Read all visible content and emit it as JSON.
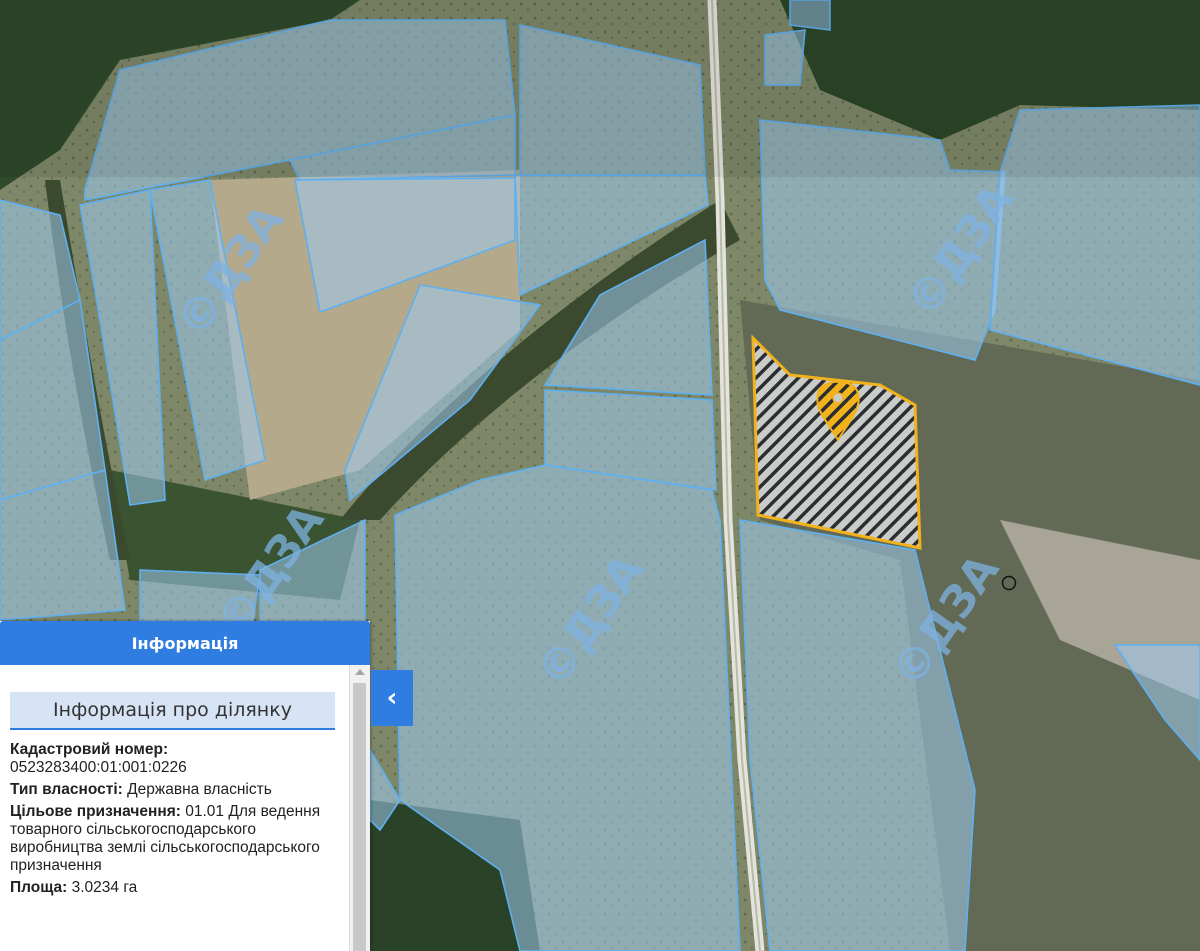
{
  "map": {
    "watermark": "©ДЗА",
    "colors": {
      "parcel_fill": "#9ecbf0",
      "parcel_border": "#5fb0f0",
      "selected_border": "#f2b21b",
      "road": "#e4e4dc"
    },
    "selected_marker_icon": "location-pin-icon",
    "point_icon": "circle-marker-icon"
  },
  "info_panel": {
    "header": "Інформація",
    "section_title": "Інформація про ділянку",
    "collapse_icon": "chevron-left-icon",
    "fields": {
      "cadastral_label": "Кадастровий номер:",
      "cadastral_value": "0523283400:01:001:0226",
      "ownership_label": "Тип власності:",
      "ownership_value": "Державна власність",
      "purpose_label": "Цільове призначення:",
      "purpose_value": "01.01 Для ведення товарного сільськогосподарського виробництва землі сільськогосподарського призначення",
      "area_label": "Площа:",
      "area_value": "3.0234 га"
    }
  }
}
